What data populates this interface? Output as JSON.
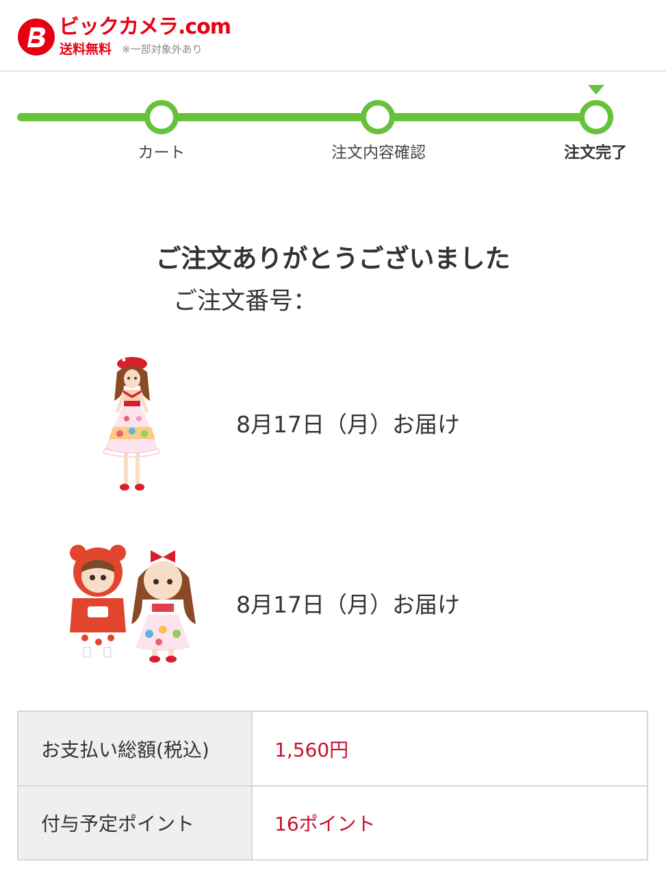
{
  "header": {
    "brand_name": "ビックカメラ.com",
    "free_shipping": "送料無料",
    "note": "※一部対象外あり",
    "brand_color": "#e60012"
  },
  "progress": {
    "accent_color": "#66c23a",
    "steps": [
      {
        "label": "カート",
        "state": "done"
      },
      {
        "label": "注文内容確認",
        "state": "done"
      },
      {
        "label": "注文完了",
        "state": "current"
      }
    ]
  },
  "confirmation": {
    "title": "ご注文ありがとうございました",
    "order_number_label": "ご注文番号："
  },
  "items": [
    {
      "delivery": "8月17日（月）お届け",
      "image": "doll-in-red-beret-and-pastel-dress"
    },
    {
      "delivery": "8月17日（月）お届け",
      "image": "two-dolls-red-bear-hoodie-and-red-bow"
    }
  ],
  "summary": {
    "rows": [
      {
        "label": "お支払い総額(税込)",
        "value": "1,560円"
      },
      {
        "label": "付与予定ポイント",
        "value": "16ポイント"
      }
    ],
    "value_color": "#c8102e"
  }
}
